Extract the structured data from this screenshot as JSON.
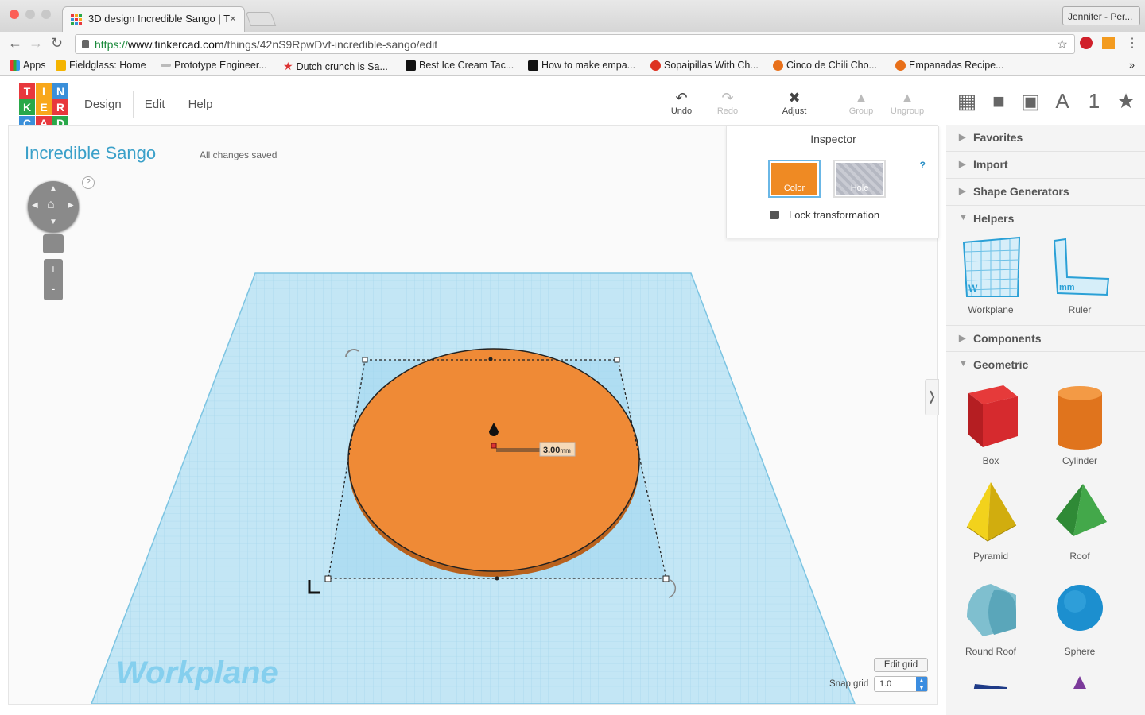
{
  "browser": {
    "tab_title": "3D design Incredible Sango | T",
    "tab_close": "×",
    "user": "Jennifer - Per...",
    "url_scheme": "https://",
    "url_domain": "www.tinkercad.com",
    "url_path": "/things/42nS9RpwDvf-incredible-sango/edit",
    "bookmarks": [
      "Apps",
      "Fieldglass: Home",
      "Prototype Engineer...",
      "Dutch crunch is Sa...",
      "Best Ice Cream Tac...",
      "How to make empa...",
      "Sopaipillas With Ch...",
      "Cinco de Chili Cho...",
      "Empanadas Recipe..."
    ],
    "more": "»"
  },
  "app": {
    "logo_letters": [
      "T",
      "I",
      "N",
      "K",
      "E",
      "R",
      "C",
      "A",
      "D"
    ],
    "menu": [
      "Design",
      "Edit",
      "Help"
    ],
    "toolbar": {
      "undo": "Undo",
      "redo": "Redo",
      "adjust": "Adjust",
      "group": "Group",
      "ungroup": "Ungroup"
    },
    "side_icons": [
      "grid-icon",
      "box-icon",
      "hole-box-icon",
      "A",
      "1",
      "★"
    ],
    "project_title": "Incredible Sango",
    "save_status": "All changes saved",
    "help_mark": "?",
    "inspector": {
      "title": "Inspector",
      "color_label": "Color",
      "hole_label": "Hole",
      "help": "?",
      "lock_label": "Lock transformation",
      "color_value": "#ef8a23"
    },
    "dimension_value": "3.00",
    "dimension_unit": "mm",
    "workplane_label": "Workplane",
    "edit_grid": "Edit grid",
    "snap_grid_label": "Snap grid",
    "snap_grid_value": "1.0",
    "panel": {
      "sections_top": [
        "Favorites",
        "Import",
        "Shape Generators"
      ],
      "helpers_title": "Helpers",
      "helpers": [
        "Workplane",
        "Ruler"
      ],
      "components_title": "Components",
      "geometric_title": "Geometric",
      "shapes": [
        "Box",
        "Cylinder",
        "Pyramid",
        "Roof",
        "Round Roof",
        "Sphere"
      ]
    }
  }
}
